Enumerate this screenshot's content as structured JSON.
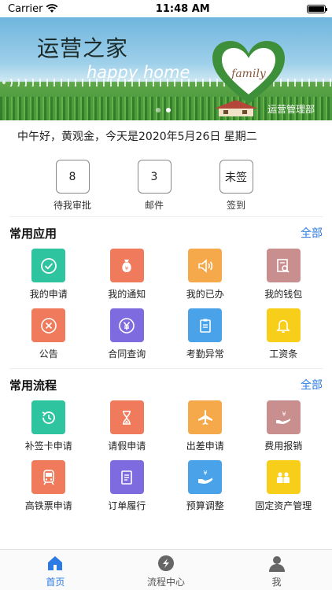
{
  "status_bar": {
    "carrier": "Carrier",
    "time": "11:48 AM",
    "battery_level": 1.0
  },
  "banner": {
    "title": "运营之家",
    "subtitle": "happy home",
    "logo_text": "family",
    "dept": "运营管理部",
    "page_count": 2,
    "active_page": 2
  },
  "greeting": "中午好，黄观金，今天是2020年5月26日 星期二",
  "stats": [
    {
      "value": "8",
      "label": "待我审批"
    },
    {
      "value": "3",
      "label": "邮件"
    },
    {
      "value": "未签",
      "label": "签到"
    }
  ],
  "common_apps": {
    "title": "常用应用",
    "all_label": "全部",
    "items": [
      {
        "label": "我的申请",
        "icon": "check-circle-icon",
        "color": "#2ec4a0"
      },
      {
        "label": "我的通知",
        "icon": "money-bag-icon",
        "color": "#f07a5c"
      },
      {
        "label": "我的已办",
        "icon": "speaker-icon",
        "color": "#f5a94a"
      },
      {
        "label": "我的钱包",
        "icon": "document-search-icon",
        "color": "#c98f8f"
      },
      {
        "label": "公告",
        "icon": "close-circle-icon",
        "color": "#f07a5c"
      },
      {
        "label": "合同查询",
        "icon": "yen-circle-icon",
        "color": "#7f6be0"
      },
      {
        "label": "考勤异常",
        "icon": "clipboard-icon",
        "color": "#4aa3e8"
      },
      {
        "label": "工资条",
        "icon": "bell-icon",
        "color": "#f7cf1a"
      }
    ]
  },
  "common_flows": {
    "title": "常用流程",
    "all_label": "全部",
    "items": [
      {
        "label": "补签卡申请",
        "icon": "clock-back-icon",
        "color": "#2ec4a0"
      },
      {
        "label": "请假申请",
        "icon": "hourglass-icon",
        "color": "#f07a5c"
      },
      {
        "label": "出差申请",
        "icon": "airplane-icon",
        "color": "#f5a94a"
      },
      {
        "label": "费用报销",
        "icon": "yen-hand-icon",
        "color": "#c98f8f"
      },
      {
        "label": "高铁票申请",
        "icon": "train-icon",
        "color": "#f07a5c"
      },
      {
        "label": "订单履行",
        "icon": "document-icon",
        "color": "#7f6be0"
      },
      {
        "label": "预算调整",
        "icon": "yen-hand-up-icon",
        "color": "#4aa3e8"
      },
      {
        "label": "固定资产管理",
        "icon": "people-icon",
        "color": "#f7cf1a"
      }
    ]
  },
  "tabbar": [
    {
      "label": "首页",
      "icon": "home-icon",
      "active": true
    },
    {
      "label": "流程中心",
      "icon": "flow-icon",
      "active": false
    },
    {
      "label": "我",
      "icon": "person-icon",
      "active": false
    }
  ],
  "colors": {
    "accent": "#2c7be5"
  }
}
